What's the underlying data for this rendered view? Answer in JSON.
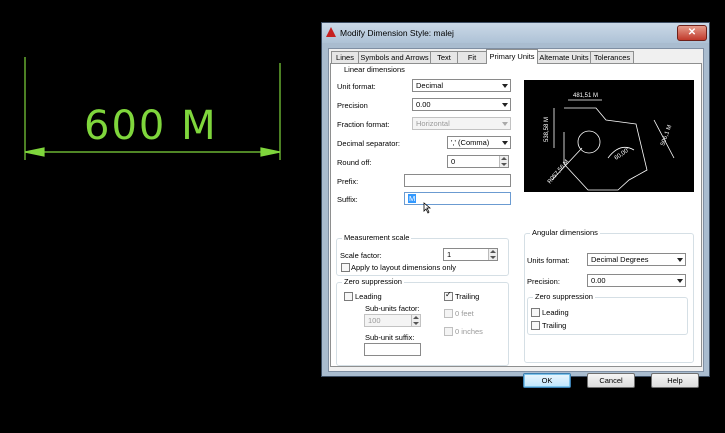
{
  "canvas": {
    "dimension_text": "600 M",
    "color": "#7fd63c"
  },
  "dialog": {
    "title": "Modify Dimension Style: malej",
    "close": "✕",
    "tabs": [
      "Lines",
      "Symbols and Arrows",
      "Text",
      "Fit",
      "Primary Units",
      "Alternate Units",
      "Tolerances"
    ],
    "active_tab": "Primary Units",
    "linear": {
      "group_title": "Linear dimensions",
      "unit_format_label": "Unit format:",
      "unit_format_value": "Decimal",
      "precision_label": "Precision",
      "precision_value": "0.00",
      "fraction_format_label": "Fraction format:",
      "fraction_format_value": "Horizontal",
      "decimal_separator_label": "Decimal separator:",
      "decimal_separator_value": "',' (Comma)",
      "round_off_label": "Round off:",
      "round_off_value": "0",
      "prefix_label": "Prefix:",
      "prefix_value": "",
      "suffix_label": "Suffix:",
      "suffix_value": "M"
    },
    "measurement_scale": {
      "group_title": "Measurement scale",
      "scale_factor_label": "Scale factor:",
      "scale_factor_value": "1",
      "apply_layout_label": "Apply to layout dimensions only"
    },
    "zero_suppression": {
      "group_title": "Zero suppression",
      "leading_label": "Leading",
      "trailing_label": "Trailing",
      "sub_units_factor_label": "Sub-units factor:",
      "sub_units_factor_value": "100",
      "feet_label": "0 feet",
      "inches_label": "0 inches",
      "sub_unit_suffix_label": "Sub-unit suffix:"
    },
    "preview": {
      "dims": [
        "481,51 M",
        "538,58 M",
        "506,1 M",
        "60,00°",
        "R057,56 M"
      ]
    },
    "angular": {
      "group_title": "Angular dimensions",
      "units_format_label": "Units format:",
      "units_format_value": "Decimal Degrees",
      "precision_label": "Precision:",
      "precision_value": "0.00",
      "zero_group_title": "Zero suppression",
      "leading_label": "Leading",
      "trailing_label": "Trailing"
    },
    "buttons": {
      "ok": "OK",
      "cancel": "Cancel",
      "help": "Help"
    }
  }
}
